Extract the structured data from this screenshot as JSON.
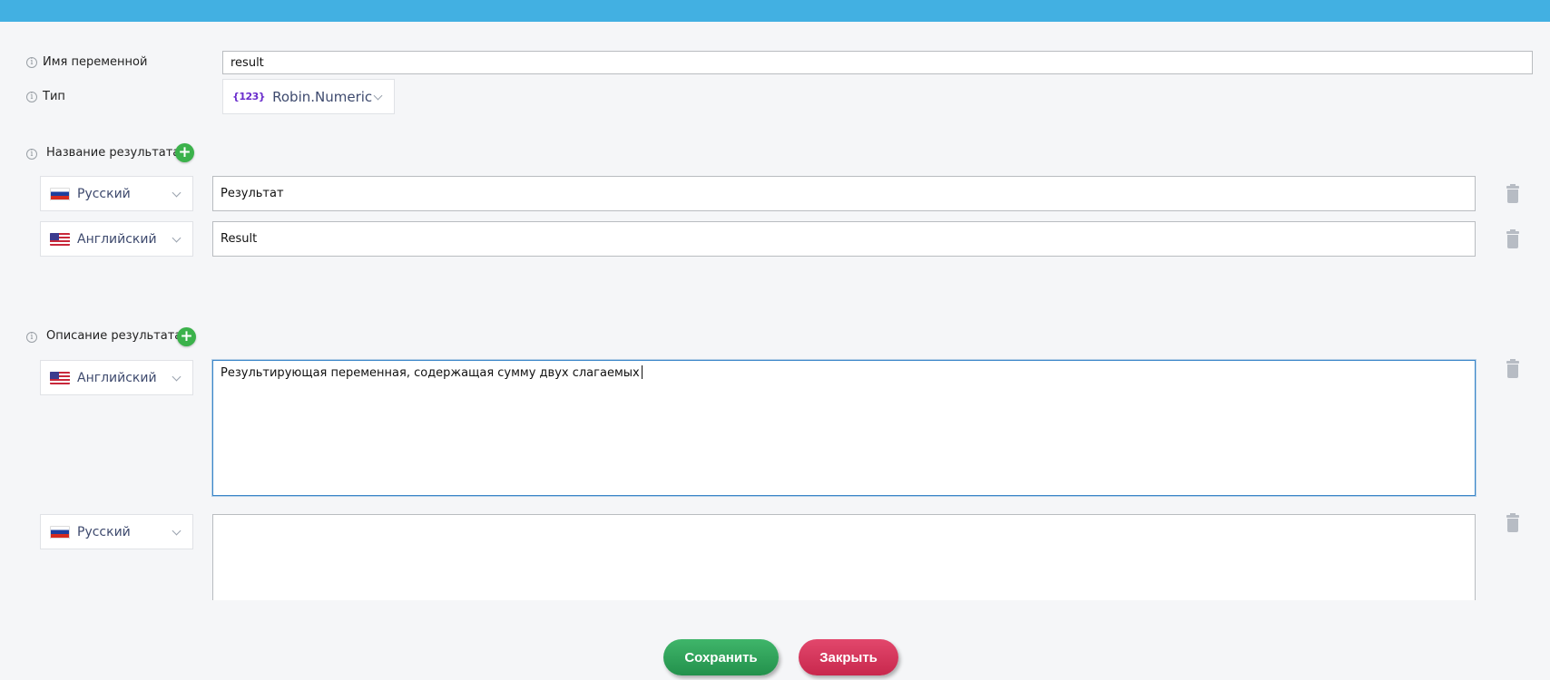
{
  "variable": {
    "name_label": "Имя переменной",
    "name_value": "result",
    "type_label": "Тип",
    "type_badge": "{123}",
    "type_value": "Robin.Numeric"
  },
  "result_name": {
    "label": "Название результата",
    "rows": [
      {
        "lang": "Русский",
        "flag": "ru",
        "value": "Результат"
      },
      {
        "lang": "Английский",
        "flag": "us",
        "value": "Result"
      }
    ]
  },
  "result_description": {
    "label": "Описание результата",
    "rows": [
      {
        "lang": "Английский",
        "flag": "us",
        "value": "Результирующая переменная, содержащая сумму двух слагаемых"
      },
      {
        "lang": "Русский",
        "flag": "ru",
        "value": ""
      }
    ]
  },
  "buttons": {
    "save": "Сохранить",
    "close": "Закрыть"
  },
  "colors": {
    "topbar": "#42b0e2",
    "add": "#3bb24b",
    "save": "#2ea35a",
    "close": "#d4345a",
    "focus": "#3b86c9"
  }
}
